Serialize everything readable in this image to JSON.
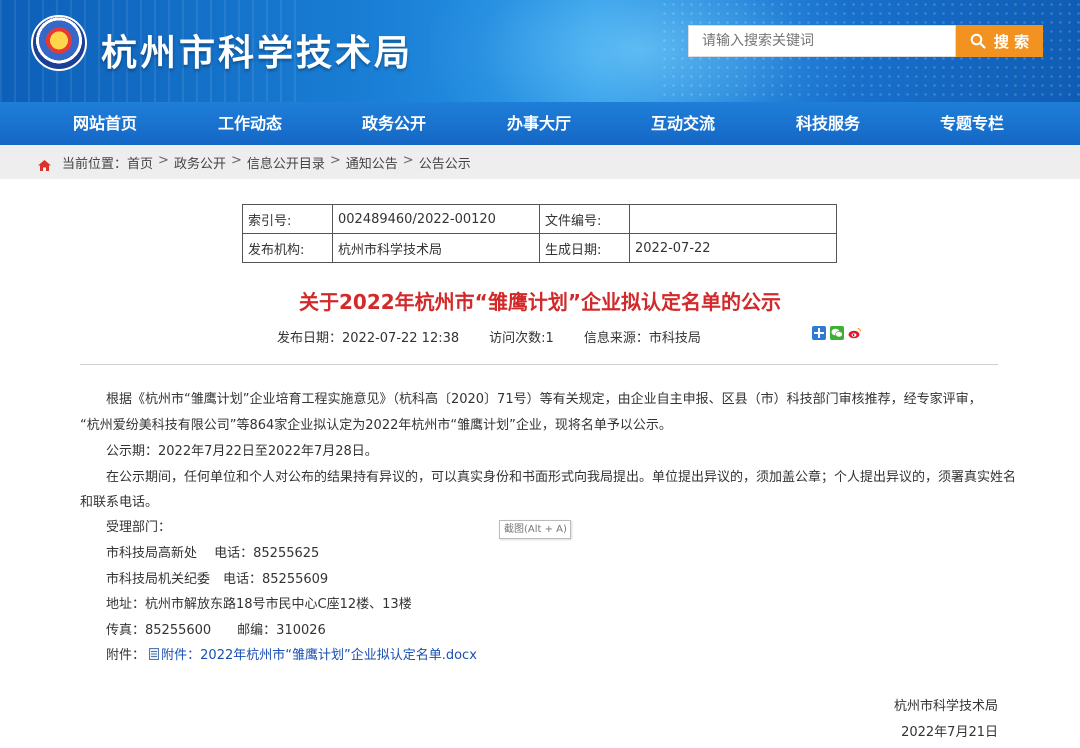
{
  "header": {
    "site_title": "杭州市科学技术局",
    "search_placeholder": "请输入搜索关键词",
    "search_button": "搜 索"
  },
  "nav": {
    "items": [
      "网站首页",
      "工作动态",
      "政务公开",
      "办事大厅",
      "互动交流",
      "科技服务",
      "专题专栏"
    ]
  },
  "breadcrumb": {
    "prefix": "当前位置：",
    "items": [
      "首页",
      "政务公开",
      "信息公开目录",
      "通知公告",
      "公告公示"
    ],
    "separator": ">"
  },
  "meta": {
    "index_label": "索引号:",
    "index_value": "002489460/2022-00120",
    "doc_no_label": "文件编号:",
    "doc_no_value": "",
    "publisher_label": "发布机构:",
    "publisher_value": "杭州市科学技术局",
    "date_label": "生成日期:",
    "date_value": "2022-07-22"
  },
  "article": {
    "title": "关于2022年杭州市“雏鹰计划”企业拟认定名单的公示",
    "publish_date": "发布日期：2022-07-22 12:38",
    "visits": "访问次数:1",
    "source": "信息来源：市科技局",
    "paragraphs": [
      "根据《杭州市“雏鹰计划”企业培育工程实施意见》（杭科高〔2020〕71号）等有关规定，由企业自主申报、区县（市）科技部门审核推荐，经专家评审，",
      "“杭州爱纷美科技有限公司”等864家企业拟认定为2022年杭州市“雏鹰计划”企业，现将名单予以公示。",
      "公示期：2022年7月22日至2022年7月28日。",
      "在公示期间，任何单位和个人对公布的结果持有异议的，可以真实身份和书面形式向我局提出。单位提出异议的，须加盖公章；个人提出异议的，须署真实姓名",
      "和联系电话。",
      "受理部门：",
      "市科技局高新处　 电话：85255625",
      "市科技局机关纪委　电话：85255609",
      "地址：杭州市解放东路18号市民中心C座12楼、13楼",
      "传真：85255600　　邮编：310026"
    ],
    "attachment_label": "附件：",
    "attachment_link": "附件：2022年杭州市“雏鹰计划”企业拟认定名单.docx",
    "signature_org": "杭州市科学技术局",
    "signature_date": "2022年7月21日"
  },
  "tooltip": "截图(Alt + A)",
  "colors": {
    "nav_blue": "#1567c6",
    "title_red": "#d22a2a",
    "search_orange": "#f29220",
    "link_blue": "#1a4fb3"
  }
}
